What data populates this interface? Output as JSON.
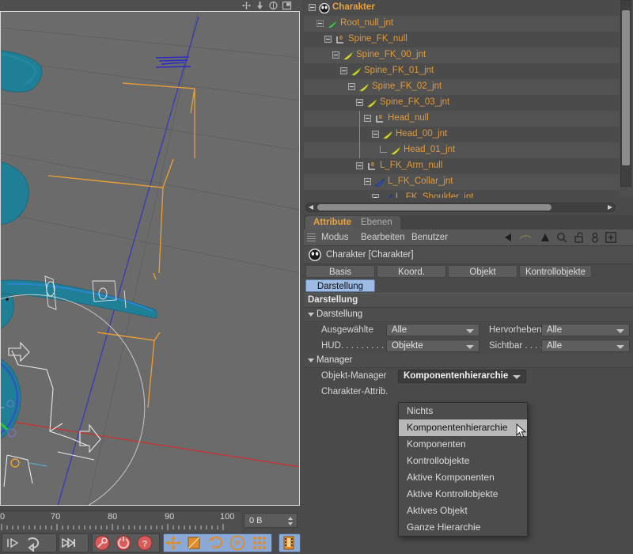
{
  "viewport": {
    "nav_icons": [
      "pan-icon",
      "dolly-icon",
      "rotate-icon",
      "maximize-icon"
    ],
    "colors": {
      "background": "#6b6b6b",
      "character_mesh": "#1f7f96",
      "rig_control": "#f0a030",
      "y_axis": "#3a3ab8",
      "x_axis": "#d03030",
      "z_axis": "#32c832",
      "selection_outline": "#e8e8e8"
    }
  },
  "timeline": {
    "ticks": [
      "0",
      "70",
      "80",
      "90",
      "100"
    ],
    "frame_field_value": "0 B",
    "frame_field_placeholder": "0 B"
  },
  "bottom_toolbar": {
    "groups": [
      {
        "buttons": [
          "play-forward-icon",
          "loop-icon"
        ],
        "selected": false
      },
      {
        "buttons": [
          "go-to-end-icon"
        ],
        "selected": false
      },
      {
        "buttons": [
          "record-key-icon",
          "autokey-icon",
          "key-selection-icon"
        ],
        "selected": false
      },
      {
        "buttons": [
          "move-tool-icon",
          "scale-tool-icon",
          "rotate-tool-icon",
          "parametric-tool-icon",
          "points-tool-icon"
        ],
        "selected": true
      },
      {
        "buttons": [
          "render-view-icon"
        ],
        "selected": true
      }
    ]
  },
  "object_manager": {
    "rows": [
      {
        "label": "Charakter",
        "depth": 0,
        "icon": "character-icon",
        "expander": "open",
        "root": true
      },
      {
        "label": "Root_null_jnt",
        "depth": 1,
        "icon": "joint-green-icon",
        "expander": "dotted",
        "root": false
      },
      {
        "label": "Spine_FK_null",
        "depth": 2,
        "icon": "null-axis-icon",
        "expander": "open",
        "root": false
      },
      {
        "label": "Spine_FK_00_jnt",
        "depth": 3,
        "icon": "joint-yellow-icon",
        "expander": "open",
        "root": false
      },
      {
        "label": "Spine_FK_01_jnt",
        "depth": 4,
        "icon": "joint-yellow-icon",
        "expander": "open",
        "root": false
      },
      {
        "label": "Spine_FK_02_jnt",
        "depth": 5,
        "icon": "joint-yellow-icon",
        "expander": "open",
        "root": false
      },
      {
        "label": "Spine_FK_03_jnt",
        "depth": 6,
        "icon": "joint-yellow-icon",
        "expander": "open",
        "root": false
      },
      {
        "label": "Head_null",
        "depth": 7,
        "icon": "null-axis-icon",
        "expander": "open",
        "root": false
      },
      {
        "label": "Head_00_jnt",
        "depth": 8,
        "icon": "joint-yellow-icon",
        "expander": "open",
        "root": false
      },
      {
        "label": "Head_01_jnt",
        "depth": 9,
        "icon": "joint-yellow-icon",
        "expander": "leaf",
        "root": false
      },
      {
        "label": "L_FK_Arm_null",
        "depth": 6,
        "icon": "null-axis-icon",
        "expander": "open",
        "root": false
      },
      {
        "label": "L_FK_Collar_jnt",
        "depth": 7,
        "icon": "joint-blue-icon",
        "expander": "open",
        "root": false
      },
      {
        "label": "L_FK_Shoulder_jnt",
        "depth": 8,
        "icon": "joint-blue-icon",
        "expander": "open",
        "root": false
      }
    ]
  },
  "attribute_manager": {
    "tabs": [
      {
        "label": "Attribute",
        "active": true
      },
      {
        "label": "Ebenen",
        "active": false
      }
    ],
    "menus": [
      "Modus",
      "Bearbeiten",
      "Benutzer"
    ],
    "tools": [
      "back-arrow-icon",
      "forward-arrow-icon",
      "up-arrow-icon",
      "search-icon",
      "lock-open-icon",
      "person-icon",
      "add-box-icon"
    ],
    "object_header": "Charakter [Charakter]",
    "object_icon": "character-icon",
    "property_tabs": [
      "Basis",
      "Koord.",
      "Objekt",
      "Kontrollobjekte"
    ],
    "property_tabs_row2": [
      {
        "label": "Darstellung",
        "selected": true
      }
    ],
    "section_title": "Darstellung",
    "groups": [
      {
        "title": "Darstellung",
        "rows": [
          {
            "label_left": "Ausgewählte",
            "value_left": "Alle",
            "label_right": "Hervorheben",
            "value_right": "Alle"
          },
          {
            "label_left": "HUD. . . . . . . . .",
            "value_left": "Objekte",
            "label_right": "Sichtbar . . . .",
            "value_right": "Alle"
          }
        ]
      },
      {
        "title": "Manager",
        "rows": [
          {
            "label_left": "Objekt-Manager",
            "value_left": "Komponentenhierarchie"
          },
          {
            "label_left": "Charakter-Attrib.",
            "value_left": ""
          }
        ]
      }
    ]
  },
  "dropdown": {
    "items": [
      {
        "label": "Nichts",
        "highlighted": false
      },
      {
        "label": "Komponentenhierarchie",
        "highlighted": true
      },
      {
        "label": "Komponenten",
        "highlighted": false
      },
      {
        "label": "Kontrollobjekte",
        "highlighted": false
      },
      {
        "label": "Aktive Komponenten",
        "highlighted": false
      },
      {
        "label": "Aktive Kontrollobjekte",
        "highlighted": false
      },
      {
        "label": "Aktives Objekt",
        "highlighted": false
      },
      {
        "label": "Ganze Hierarchie",
        "highlighted": false
      }
    ]
  },
  "theme": {
    "accent_orange": "#e09a3c",
    "selection_blue": "#9dbbe4",
    "panel_bg": "#4a4a4a",
    "viewport_bg": "#6b6b6b"
  }
}
